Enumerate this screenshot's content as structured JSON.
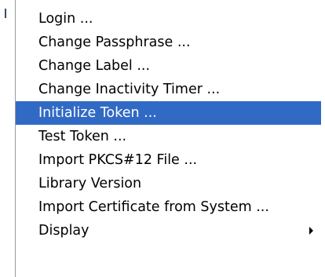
{
  "menu": {
    "items": [
      {
        "label": "Login ..."
      },
      {
        "label": "Change Passphrase ..."
      },
      {
        "label": "Change Label ..."
      },
      {
        "label": "Change Inactivity Timer ..."
      },
      {
        "label": "Initialize Token ..."
      },
      {
        "label": "Test Token ..."
      },
      {
        "label": "Import PKCS#12 File ..."
      },
      {
        "label": "Library Version"
      },
      {
        "label": "Import Certificate from System ..."
      },
      {
        "label": "Display"
      }
    ],
    "selected_index": 4,
    "selected_color": "#316ac5",
    "submenu_indicator": "chevron-right-icon"
  }
}
